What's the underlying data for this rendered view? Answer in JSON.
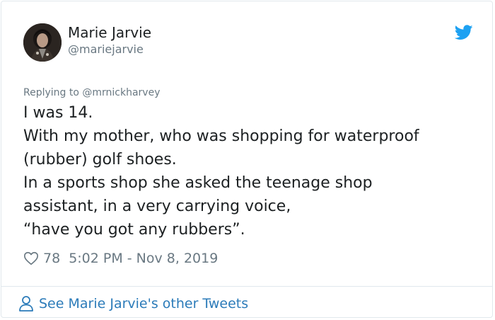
{
  "author": {
    "display_name": "Marie Jarvie",
    "handle": "@mariejarvie",
    "avatar_icon": "profile-photo"
  },
  "replying_to": "Replying to @mrnickharvey",
  "tweet": {
    "lines": [
      "I was 14.",
      "With my mother, who was shopping for waterproof",
      "(rubber) golf shoes.",
      "In a sports shop she asked the teenage shop",
      "assistant, in a very carrying voice,",
      "“have you got any rubbers”."
    ]
  },
  "meta": {
    "like_count": "78",
    "timestamp": "5:02 PM - Nov 8, 2019"
  },
  "footer": {
    "see_more_label": "See Marie Jarvie's other Tweets"
  },
  "icons": {
    "brand": "twitter-bird-icon",
    "like": "heart-icon",
    "profile": "person-icon"
  },
  "colors": {
    "brand_blue": "#1da1f2",
    "link_blue": "#2b7bb9",
    "secondary_text": "#697882",
    "primary_text": "#1c2022",
    "border": "#e1e8ed"
  }
}
